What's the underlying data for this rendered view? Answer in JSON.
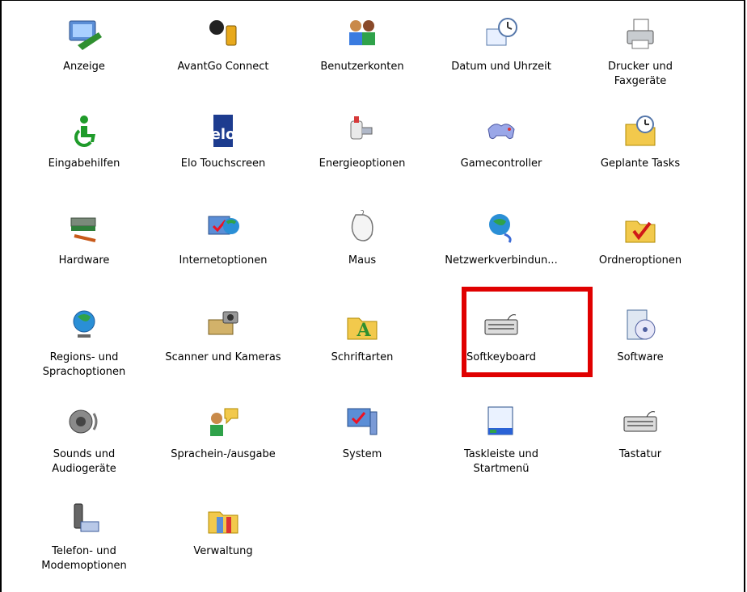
{
  "control_panel": {
    "items": [
      {
        "label": "Anzeige",
        "icon": "display-icon"
      },
      {
        "label": "AvantGo Connect",
        "icon": "avantgo-icon"
      },
      {
        "label": "Benutzerkonten",
        "icon": "user-accounts-icon"
      },
      {
        "label": "Datum und Uhrzeit",
        "icon": "date-time-icon"
      },
      {
        "label": "Drucker und\nFaxgeräte",
        "icon": "printer-icon"
      },
      {
        "label": "Eingabehilfen",
        "icon": "accessibility-icon"
      },
      {
        "label": "Elo Touchscreen",
        "icon": "elo-icon"
      },
      {
        "label": "Energieoptionen",
        "icon": "power-icon"
      },
      {
        "label": "Gamecontroller",
        "icon": "gamecontroller-icon"
      },
      {
        "label": "Geplante Tasks",
        "icon": "scheduled-tasks-icon"
      },
      {
        "label": "Hardware",
        "icon": "hardware-icon"
      },
      {
        "label": "Internetoptionen",
        "icon": "internet-options-icon"
      },
      {
        "label": "Maus",
        "icon": "mouse-icon"
      },
      {
        "label": "Netzwerkverbindun...",
        "icon": "network-icon"
      },
      {
        "label": "Ordneroptionen",
        "icon": "folder-options-icon"
      },
      {
        "label": "Regions- und\nSprachoptionen",
        "icon": "globe-icon"
      },
      {
        "label": "Scanner und Kameras",
        "icon": "scanner-icon"
      },
      {
        "label": "Schriftarten",
        "icon": "fonts-icon"
      },
      {
        "label": "Softkeyboard",
        "icon": "keyboard-icon"
      },
      {
        "label": "Software",
        "icon": "software-icon"
      },
      {
        "label": "Sounds und\nAudiogeräte",
        "icon": "speaker-icon"
      },
      {
        "label": "Sprachein-/ausgabe",
        "icon": "speech-icon"
      },
      {
        "label": "System",
        "icon": "system-icon"
      },
      {
        "label": "Taskleiste und\nStartmenü",
        "icon": "taskbar-icon"
      },
      {
        "label": "Tastatur",
        "icon": "keyboard-icon"
      },
      {
        "label": "Telefon- und\nModemoptionen",
        "icon": "phone-modem-icon"
      },
      {
        "label": "Verwaltung",
        "icon": "admin-tools-icon"
      }
    ]
  },
  "colors": {
    "highlight": "#e00000"
  }
}
